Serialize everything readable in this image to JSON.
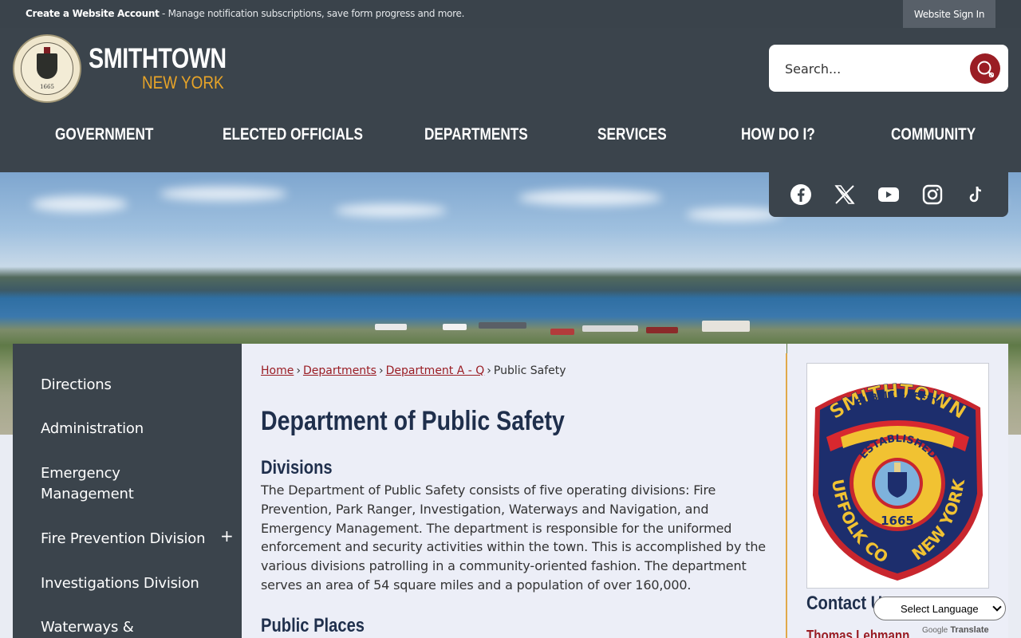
{
  "topbar": {
    "create_account": "Create a Website Account",
    "create_account_rest": " - Manage notification subscriptions, save form progress and more.",
    "signin": "Website Sign In"
  },
  "brand": {
    "name": "SMITHTOWN",
    "state": "NEW YORK",
    "seal_year": "1665"
  },
  "search": {
    "placeholder": "Search..."
  },
  "nav": [
    "GOVERNMENT",
    "ELECTED OFFICIALS",
    "DEPARTMENTS",
    "SERVICES",
    "HOW DO I?",
    "COMMUNITY"
  ],
  "social": [
    "facebook-icon",
    "x-icon",
    "youtube-icon",
    "instagram-icon",
    "tiktok-icon"
  ],
  "sidebar": {
    "items": [
      {
        "label": "Directions"
      },
      {
        "label": "Administration"
      },
      {
        "label": "Emergency Management"
      },
      {
        "label": "Fire Prevention Division"
      },
      {
        "label": "Investigations Division"
      },
      {
        "label": "Waterways &"
      }
    ],
    "expand_symbol": "+"
  },
  "breadcrumb": {
    "home": "Home",
    "departments": "Departments",
    "dept_aq": "Department A - Q",
    "current": "Public Safety",
    "sep": "›"
  },
  "main": {
    "title": "Department of Public Safety",
    "divisions_heading": "Divisions",
    "divisions_text": "The Department of Public Safety consists of five operating divisions: Fire Prevention, Park Ranger, Investigation, Waterways and Navigation, and Emergency Management. The department is responsible for the uniformed enforcement and security activities within the town. This is accomplished by the various divisions patrolling in a community-oriented fashion. The department serves an area of 54 square miles and a population of over 160,000.",
    "public_places_heading": "Public Places"
  },
  "patch": {
    "top": "SMITHTOWN",
    "banner": "PUBLIC SAFETY",
    "established": "ESTABLISHED",
    "year": "1665",
    "left": "SUFFOLK CO.",
    "right": "NEW YORK"
  },
  "contact": {
    "heading": "Contact U",
    "person": "Thomas Lehmann"
  },
  "translate": {
    "label": "Select Language",
    "powered_google": "Google",
    "powered_translate": "Translate"
  },
  "colors": {
    "header_bg": "#3b444c",
    "accent_red": "#9a1d24",
    "accent_gold": "#e8a428",
    "heading_navy": "#1f2f4c"
  }
}
